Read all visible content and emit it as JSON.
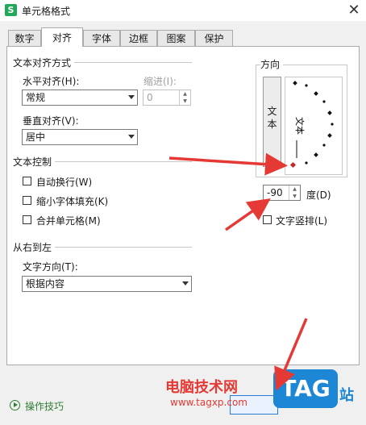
{
  "window": {
    "title": "单元格格式",
    "app_icon_letter": "S",
    "close_glyph": "✕"
  },
  "tabs": [
    {
      "label": "数字",
      "active": false
    },
    {
      "label": "对齐",
      "active": true
    },
    {
      "label": "字体",
      "active": false
    },
    {
      "label": "边框",
      "active": false
    },
    {
      "label": "图案",
      "active": false
    },
    {
      "label": "保护",
      "active": false
    }
  ],
  "alignment": {
    "group_label": "文本对齐方式",
    "horizontal_label": "水平对齐(H):",
    "horizontal_value": "常规",
    "indent_label": "缩进(I):",
    "indent_value": "0",
    "vertical_label": "垂直对齐(V):",
    "vertical_value": "居中"
  },
  "text_control": {
    "group_label": "文本控制",
    "wrap_text": "自动换行(W)",
    "shrink_to_fit": "缩小字体填充(K)",
    "merge_cells": "合并单元格(M)"
  },
  "rtl": {
    "group_label": "从右到左",
    "direction_label": "文字方向(T):",
    "direction_value": "根据内容"
  },
  "orientation": {
    "group_label": "方向",
    "vertical_text_chars": "文\n本",
    "dial_text": "文本",
    "degrees_value": "-90",
    "degrees_label": "度(D)",
    "vertical_stack_label": "文字竖排(L)"
  },
  "footer": {
    "tips_link": "操作技巧",
    "watermark_text": "电脑技术网",
    "watermark_url": "www.tagxp.com",
    "tag_logo": "TAG",
    "tag_site": "站"
  },
  "colors": {
    "accent_red": "#e53935",
    "tips_green": "#2e7d32",
    "tag_blue": "#1d87d6"
  }
}
